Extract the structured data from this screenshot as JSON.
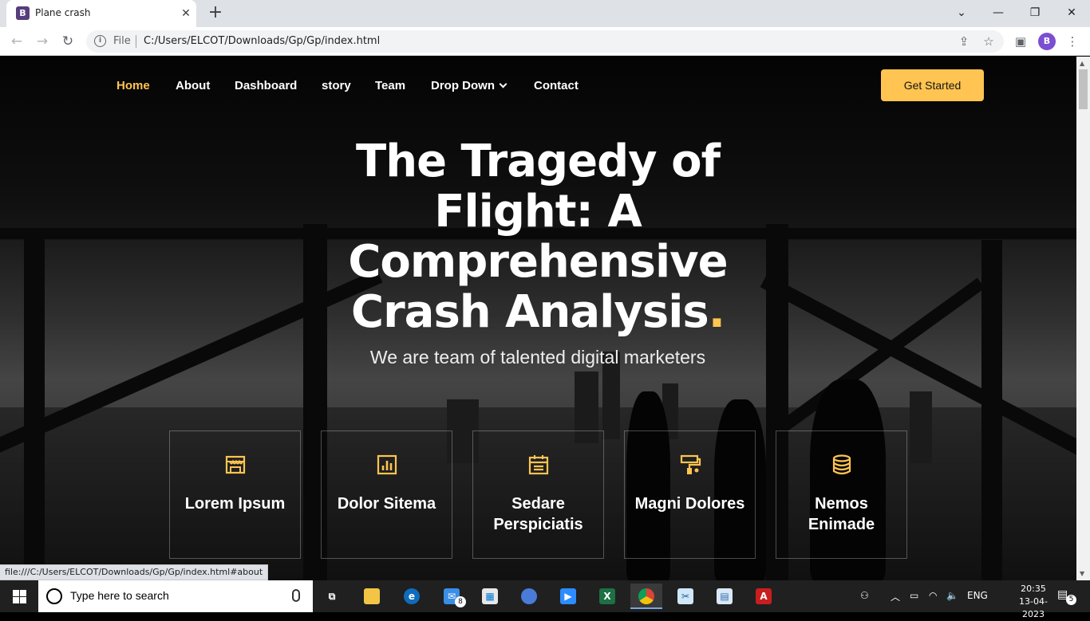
{
  "browser": {
    "tab_title": "Plane crash",
    "tab_favicon": "B",
    "address_prefix": "File",
    "url": "C:/Users/ELCOT/Downloads/Gp/Gp/index.html",
    "profile_initial": "B",
    "status_url": "file:///C:/Users/ELCOT/Downloads/Gp/Gp/index.html#about"
  },
  "nav": {
    "items": [
      "Home",
      "About",
      "Dashboard",
      "story",
      "Team",
      "Drop Down",
      "Contact"
    ],
    "active": "Home",
    "cta": "Get Started"
  },
  "hero": {
    "title_line1": "The Tragedy of",
    "title_line2": "Flight: A",
    "title_line3": "Comprehensive",
    "title_line4": "Crash Analysis",
    "title_dot": ".",
    "subtitle": "We are team of talented digital marketers"
  },
  "features": [
    {
      "icon": "store-icon",
      "label": "Lorem Ipsum"
    },
    {
      "icon": "bar-chart-icon",
      "label": "Dolor Sitema"
    },
    {
      "icon": "calendar-icon",
      "label": "Sedare Perspiciatis"
    },
    {
      "icon": "paint-roller-icon",
      "label": "Magni Dolores"
    },
    {
      "icon": "database-icon",
      "label": "Nemos Enimade"
    }
  ],
  "taskbar": {
    "search_placeholder": "Type here to search",
    "mail_badge": "8",
    "language": "ENG",
    "time": "20:35",
    "date": "13-04-2023",
    "notification_count": "5"
  },
  "colors": {
    "accent": "#ffc451",
    "chrome_bg": "#dee1e6",
    "taskbar_bg": "#202020"
  }
}
